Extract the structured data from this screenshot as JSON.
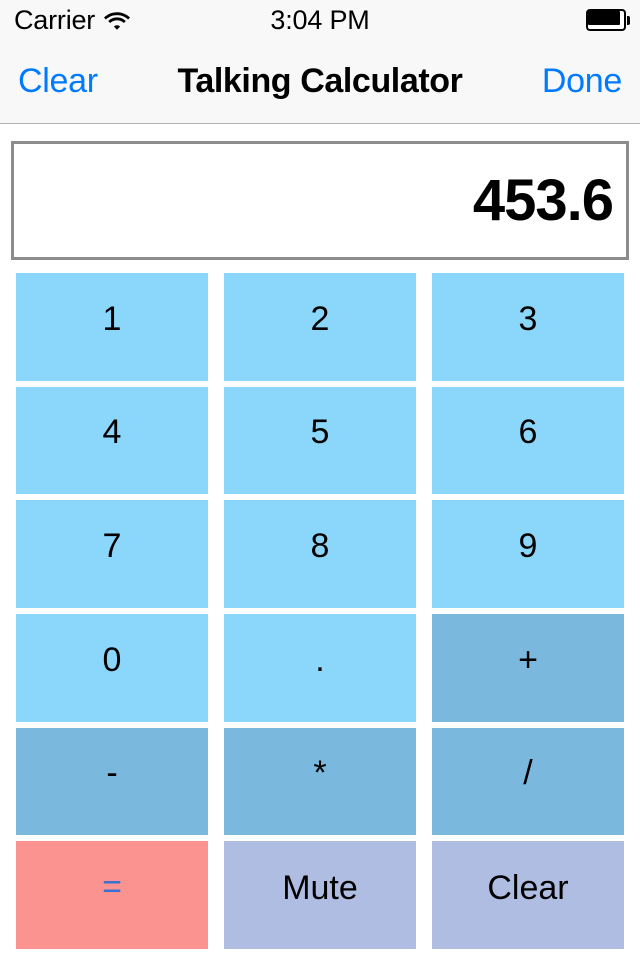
{
  "status_bar": {
    "carrier": "Carrier",
    "wifi_icon": "wifi-icon",
    "time": "3:04 PM",
    "battery_icon": "battery-full-icon"
  },
  "nav_bar": {
    "left_button": "Clear",
    "title": "Talking Calculator",
    "right_button": "Done"
  },
  "display": {
    "value": "453.6"
  },
  "keypad": {
    "keys": [
      {
        "label": "1",
        "type": "digit",
        "name": "key-1"
      },
      {
        "label": "2",
        "type": "digit",
        "name": "key-2"
      },
      {
        "label": "3",
        "type": "digit",
        "name": "key-3"
      },
      {
        "label": "4",
        "type": "digit",
        "name": "key-4"
      },
      {
        "label": "5",
        "type": "digit",
        "name": "key-5"
      },
      {
        "label": "6",
        "type": "digit",
        "name": "key-6"
      },
      {
        "label": "7",
        "type": "digit",
        "name": "key-7"
      },
      {
        "label": "8",
        "type": "digit",
        "name": "key-8"
      },
      {
        "label": "9",
        "type": "digit",
        "name": "key-9"
      },
      {
        "label": "0",
        "type": "digit",
        "name": "key-0"
      },
      {
        "label": ".",
        "type": "dot",
        "name": "key-decimal"
      },
      {
        "label": "+",
        "type": "op",
        "name": "key-plus"
      },
      {
        "label": "-",
        "type": "op",
        "name": "key-minus"
      },
      {
        "label": "*",
        "type": "op",
        "name": "key-multiply"
      },
      {
        "label": "/",
        "type": "op",
        "name": "key-divide"
      },
      {
        "label": "=",
        "type": "equals",
        "name": "key-equals"
      },
      {
        "label": "Mute",
        "type": "util",
        "name": "key-mute"
      },
      {
        "label": "Clear",
        "type": "util",
        "name": "key-clear"
      }
    ]
  },
  "colors": {
    "digit_key": "#8bd6fb",
    "operator_key": "#7bb8de",
    "equals_key": "#fb9490",
    "equals_glyph": "#3c6fd0",
    "utility_key": "#afbde2",
    "nav_tint": "#007aff",
    "chrome_bg": "#f8f8f8",
    "display_border": "#8c8c8c"
  }
}
